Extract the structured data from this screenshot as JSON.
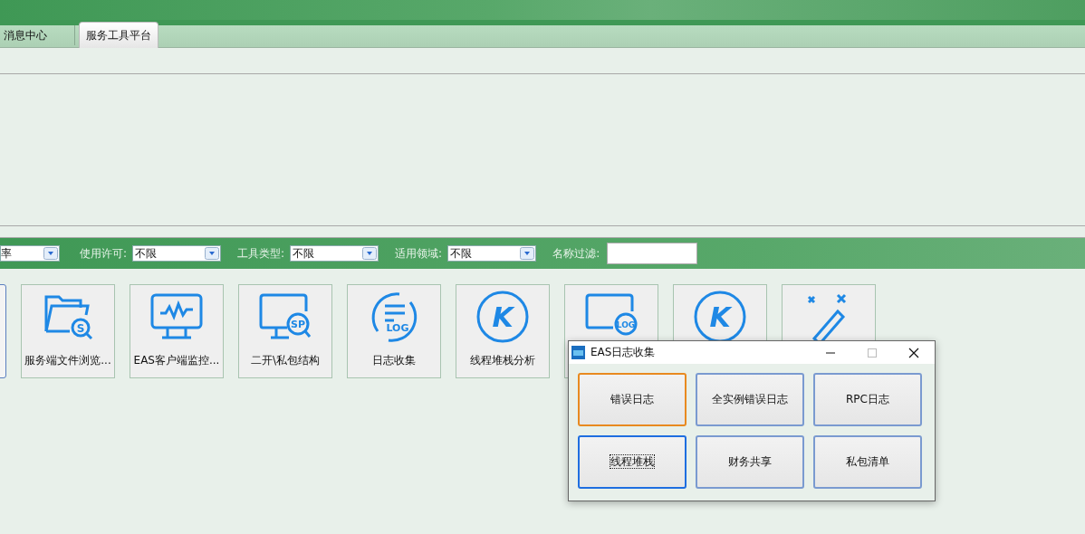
{
  "tabs": [
    {
      "label": "消息中心",
      "selected": false
    },
    {
      "label": "服务工具平台",
      "selected": true
    }
  ],
  "filters": [
    {
      "value": "率"
    },
    {
      "label": "使用许可:",
      "value": "不限"
    },
    {
      "label": "工具类型:",
      "value": "不限"
    },
    {
      "label": "适用领域:",
      "value": "不限"
    }
  ],
  "name_filter": {
    "label": "名称过滤:"
  },
  "tools": [
    {
      "kind": "stub"
    },
    {
      "kind": "folder",
      "icon_text": "S",
      "label": "服务端文件浏览..."
    },
    {
      "kind": "monitor",
      "label": "EAS客户端监控..."
    },
    {
      "kind": "sp",
      "icon_text": "SP",
      "label": "二开\\私包结构"
    },
    {
      "kind": "log",
      "icon_text": "LOG",
      "label": "日志收集"
    },
    {
      "kind": "k",
      "icon_text": "K",
      "label": "线程堆栈分析"
    },
    {
      "kind": "monlog",
      "icon_text": "LOG"
    },
    {
      "kind": "k",
      "icon_text": "K"
    },
    {
      "kind": "wand"
    }
  ],
  "dialog": {
    "title": "EAS日志收集",
    "buttons": [
      {
        "label": "错误日志",
        "hot": true,
        "focused": false
      },
      {
        "label": "全实例错误日志",
        "hot": false,
        "focused": false
      },
      {
        "label": "RPC日志",
        "hot": false,
        "focused": false
      },
      {
        "label": "线程堆栈",
        "hot": false,
        "focused": true
      },
      {
        "label": "财务共享",
        "hot": false,
        "focused": false
      },
      {
        "label": "私包清单",
        "hot": false,
        "focused": false
      }
    ]
  }
}
